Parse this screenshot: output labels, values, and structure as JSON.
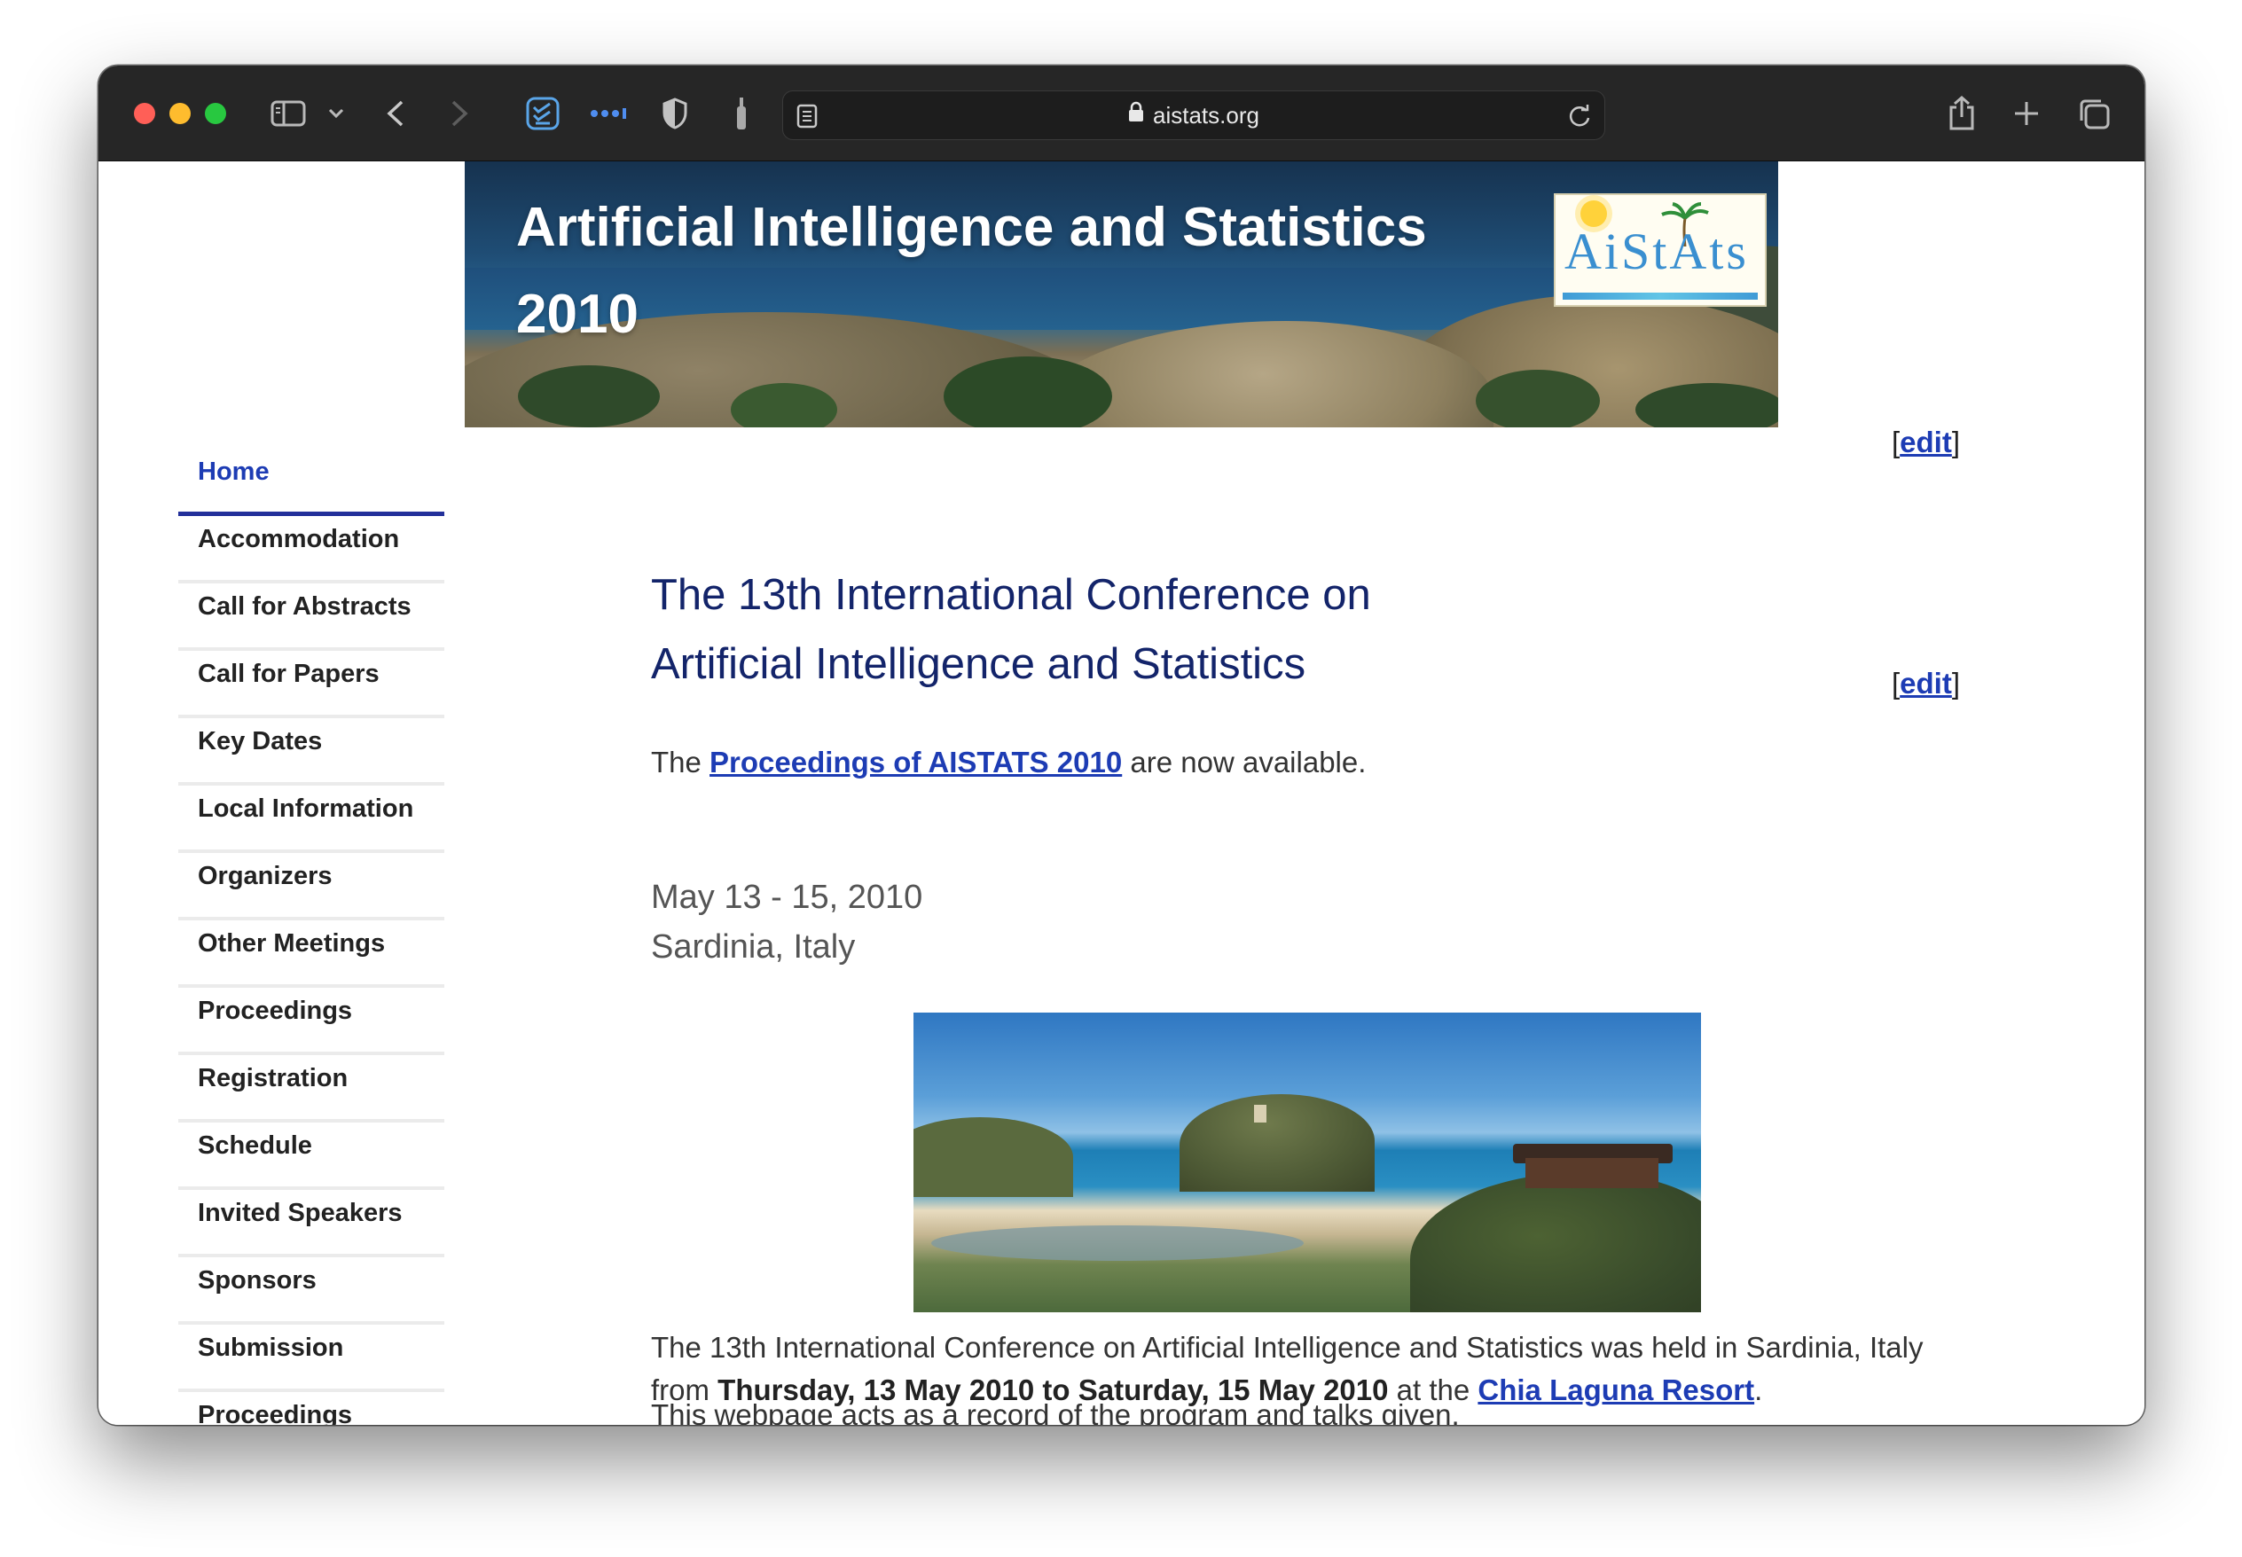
{
  "browser": {
    "url": "aistats.org"
  },
  "header": {
    "title": "Artificial Intelligence and Statistics 2010",
    "logo_text": "AiStAts"
  },
  "edit_link": {
    "text": "edit"
  },
  "sidebar": {
    "items": [
      {
        "label": "Home",
        "active": true
      },
      {
        "label": "Accommodation"
      },
      {
        "label": "Call for Abstracts"
      },
      {
        "label": "Call for Papers"
      },
      {
        "label": "Key Dates"
      },
      {
        "label": "Local Information"
      },
      {
        "label": "Organizers"
      },
      {
        "label": "Other Meetings"
      },
      {
        "label": "Proceedings"
      },
      {
        "label": "Registration"
      },
      {
        "label": "Schedule"
      },
      {
        "label": "Invited Speakers"
      },
      {
        "label": "Sponsors"
      },
      {
        "label": "Submission"
      },
      {
        "label": "Proceedings"
      }
    ]
  },
  "main": {
    "heading_line1": "The 13th International Conference on",
    "heading_line2": "Artificial Intelligence and Statistics",
    "proceedings": {
      "prefix": "The ",
      "link": "Proceedings of AISTATS 2010",
      "suffix": " are now available."
    },
    "dates": "May 13 - 15, 2010",
    "location": "Sardinia, Italy",
    "description": {
      "part1": "The 13th International Conference on Artificial Intelligence and Statistics was held in Sardinia, Italy",
      "part2": "from ",
      "bold": "Thursday, 13 May 2010 to Saturday, 15 May 2010",
      "part3": " at the ",
      "link": "Chia Laguna Resort",
      "part4": "."
    },
    "record_text": "This webpage acts as a record of the program and talks given."
  }
}
